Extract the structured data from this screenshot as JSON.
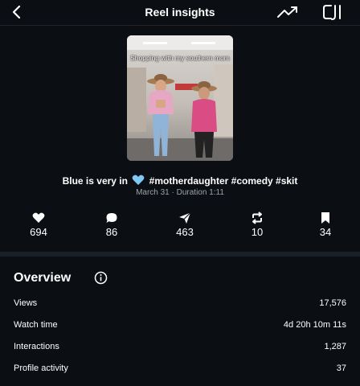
{
  "header": {
    "title": "Reel insights",
    "back_icon": "chevron-left-icon",
    "trend_icon": "trending-up-icon",
    "clip_icon": "clips-icon"
  },
  "reel": {
    "thumbnail_caption": "Shopping with my southern mom",
    "caption_before": "Blue is very in",
    "caption_emoji": "blue-heart-icon",
    "caption_after": "#motherdaughter #comedy #skit",
    "meta": "March 31 · Duration 1:11"
  },
  "stats": [
    {
      "icon": "heart-icon",
      "value": "694"
    },
    {
      "icon": "comment-icon",
      "value": "86"
    },
    {
      "icon": "share-icon",
      "value": "463"
    },
    {
      "icon": "repost-icon",
      "value": "10"
    },
    {
      "icon": "bookmark-icon",
      "value": "34"
    }
  ],
  "overview": {
    "title": "Overview",
    "info_icon": "info-icon",
    "rows": [
      {
        "label": "Views",
        "value": "17,576"
      },
      {
        "label": "Watch time",
        "value": "4d 20h 10m 11s"
      },
      {
        "label": "Interactions",
        "value": "1,287"
      },
      {
        "label": "Profile activity",
        "value": "37"
      }
    ]
  },
  "colors": {
    "background": "#0b0f14",
    "text": "#ffffff",
    "muted": "#9aa3ad",
    "heart_emoji": "#7ec8f2"
  }
}
